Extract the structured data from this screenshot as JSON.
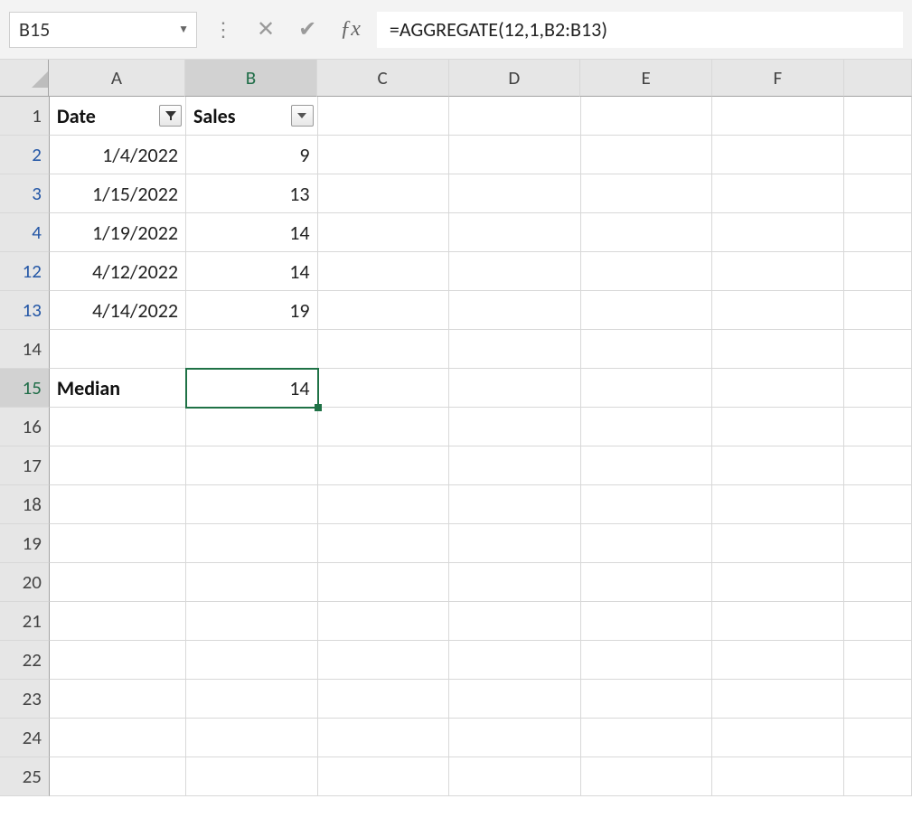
{
  "formula_bar": {
    "name_box": "B15",
    "formula": "=AGGREGATE(12,1,B2:B13)"
  },
  "columns": [
    "A",
    "B",
    "C",
    "D",
    "E",
    "F"
  ],
  "headers": {
    "A": "Date",
    "B": "Sales"
  },
  "rows": [
    {
      "num": 1,
      "filtered": false,
      "A_label": "Date",
      "B_label": "Sales",
      "is_header": true
    },
    {
      "num": 2,
      "filtered": true,
      "A": "1/4/2022",
      "B": "9"
    },
    {
      "num": 3,
      "filtered": true,
      "A": "1/15/2022",
      "B": "13"
    },
    {
      "num": 4,
      "filtered": true,
      "A": "1/19/2022",
      "B": "14"
    },
    {
      "num": 12,
      "filtered": true,
      "A": "4/12/2022",
      "B": "14"
    },
    {
      "num": 13,
      "filtered": true,
      "A": "4/14/2022",
      "B": "19"
    },
    {
      "num": 14,
      "filtered": false
    },
    {
      "num": 15,
      "filtered": false,
      "A_label": "Median",
      "B": "14",
      "active": true,
      "bold_A": true
    },
    {
      "num": 16,
      "filtered": false
    },
    {
      "num": 17,
      "filtered": false
    },
    {
      "num": 18,
      "filtered": false
    },
    {
      "num": 19,
      "filtered": false
    },
    {
      "num": 20,
      "filtered": false
    },
    {
      "num": 21,
      "filtered": false
    },
    {
      "num": 22,
      "filtered": false
    },
    {
      "num": 23,
      "filtered": false
    },
    {
      "num": 24,
      "filtered": false
    },
    {
      "num": 25,
      "filtered": false
    }
  ],
  "active": {
    "row": 15,
    "col": "B"
  }
}
